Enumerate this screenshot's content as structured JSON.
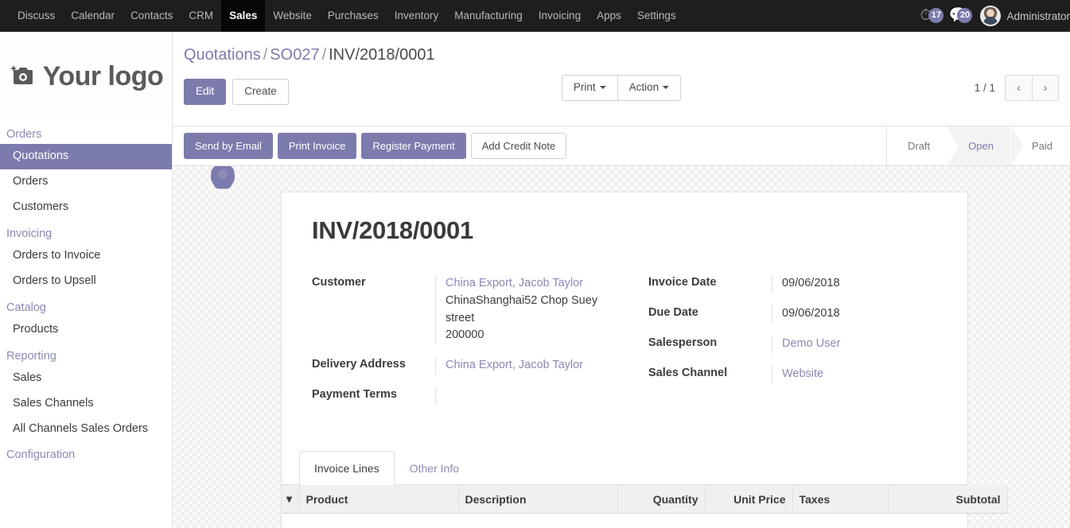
{
  "topbar": {
    "menu": [
      {
        "label": "Discuss",
        "active": false
      },
      {
        "label": "Calendar",
        "active": false
      },
      {
        "label": "Contacts",
        "active": false
      },
      {
        "label": "CRM",
        "active": false
      },
      {
        "label": "Sales",
        "active": true
      },
      {
        "label": "Website",
        "active": false
      },
      {
        "label": "Purchases",
        "active": false
      },
      {
        "label": "Inventory",
        "active": false
      },
      {
        "label": "Manufacturing",
        "active": false
      },
      {
        "label": "Invoicing",
        "active": false
      },
      {
        "label": "Apps",
        "active": false
      },
      {
        "label": "Settings",
        "active": false
      }
    ],
    "activity_count": "17",
    "messages_count": "20",
    "username": "Administrator"
  },
  "sidebar": {
    "brand": "Your logo",
    "brand_icon": "camera-icon",
    "groups": [
      {
        "title": "Orders",
        "items": [
          {
            "label": "Quotations",
            "active": true
          },
          {
            "label": "Orders",
            "active": false
          },
          {
            "label": "Customers",
            "active": false
          }
        ]
      },
      {
        "title": "Invoicing",
        "items": [
          {
            "label": "Orders to Invoice",
            "active": false
          },
          {
            "label": "Orders to Upsell",
            "active": false
          }
        ]
      },
      {
        "title": "Catalog",
        "items": [
          {
            "label": "Products",
            "active": false
          }
        ]
      },
      {
        "title": "Reporting",
        "items": [
          {
            "label": "Sales",
            "active": false
          },
          {
            "label": "Sales Channels",
            "active": false
          },
          {
            "label": "All Channels Sales Orders",
            "active": false
          }
        ]
      },
      {
        "title": "Configuration",
        "items": []
      }
    ]
  },
  "control_panel": {
    "breadcrumb": [
      {
        "label": "Quotations",
        "current": false
      },
      {
        "label": "SO027",
        "current": false
      },
      {
        "label": "INV/2018/0001",
        "current": true
      }
    ],
    "breadcrumb_separator": "/",
    "edit_label": "Edit",
    "create_label": "Create",
    "print_label": "Print",
    "action_label": "Action",
    "pager_text": "1 / 1",
    "pager_prev_icon": "chevron-left-icon",
    "pager_next_icon": "chevron-right-icon"
  },
  "statusbar": {
    "buttons": [
      {
        "label": "Send by Email",
        "primary": true
      },
      {
        "label": "Print Invoice",
        "primary": true
      },
      {
        "label": "Register Payment",
        "primary": true
      },
      {
        "label": "Add Credit Note",
        "primary": false
      }
    ],
    "stages": [
      {
        "label": "Draft",
        "active": false
      },
      {
        "label": "Open",
        "active": true
      },
      {
        "label": "Paid",
        "active": false
      }
    ]
  },
  "invoice": {
    "title": "INV/2018/0001",
    "left_fields": [
      {
        "label": "Customer",
        "value_link": "China Export, Jacob Taylor",
        "value_lines": [
          "ChinaShanghai52 Chop Suey street",
          "200000"
        ]
      },
      {
        "label": "Delivery Address",
        "value_link": "China Export, Jacob Taylor",
        "value_lines": []
      },
      {
        "label": "Payment Terms",
        "value_link": "",
        "value_lines": []
      }
    ],
    "right_fields": [
      {
        "label": "Invoice Date",
        "value": "09/06/2018",
        "is_link": false
      },
      {
        "label": "Due Date",
        "value": "09/06/2018",
        "is_link": false
      },
      {
        "label": "Salesperson",
        "value": "Demo User",
        "is_link": true
      },
      {
        "label": "Sales Channel",
        "value": "Website",
        "is_link": true
      }
    ],
    "tabs": [
      {
        "label": "Invoice Lines",
        "active": true
      },
      {
        "label": "Other Info",
        "active": false
      }
    ],
    "lines_table": {
      "columns": [
        {
          "label": "Product",
          "align": "left"
        },
        {
          "label": "Description",
          "align": "left"
        },
        {
          "label": "Quantity",
          "align": "right"
        },
        {
          "label": "Unit Price",
          "align": "right"
        },
        {
          "label": "Taxes",
          "align": "left"
        },
        {
          "label": "Subtotal",
          "align": "right"
        }
      ],
      "rows": []
    }
  },
  "colors": {
    "accent": "#7c7bad",
    "topbar_bg": "#1f1d1d",
    "link": "#8a8ab5",
    "stage_active_bg": "#f3f3f3"
  }
}
